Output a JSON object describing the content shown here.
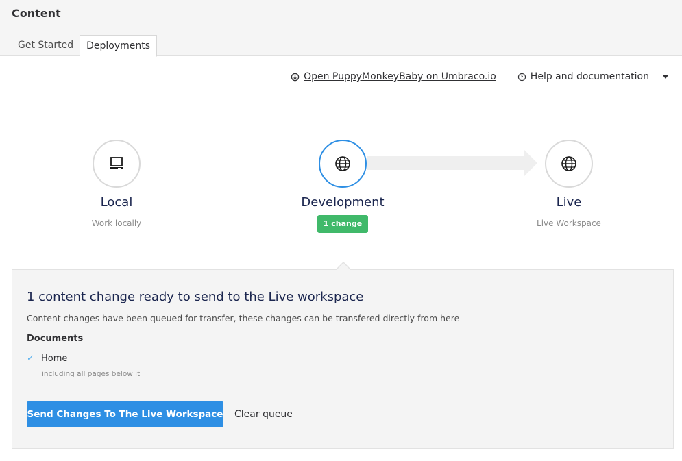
{
  "header": {
    "title": "Content",
    "tabs": [
      {
        "label": "Get Started",
        "active": false
      },
      {
        "label": "Deployments",
        "active": true
      }
    ]
  },
  "toplinks": {
    "open_project": {
      "label": "Open PuppyMonkeyBaby on Umbraco.io",
      "icon": "umbraco-cloud-icon"
    },
    "help": {
      "label": "Help and documentation",
      "icon": "question-circle-icon"
    },
    "menu_icon": "caret-down-icon"
  },
  "environments": [
    {
      "name": "Local",
      "subtitle": "Work locally",
      "icon": "laptop-icon",
      "active": false
    },
    {
      "name": "Development",
      "badge": "1 change",
      "icon": "globe-icon",
      "active": true
    },
    {
      "name": "Live",
      "subtitle": "Live Workspace",
      "icon": "globe-icon",
      "active": false
    }
  ],
  "panel": {
    "title": "1 content change ready to send to the Live workspace",
    "description": "Content changes have been queued for transfer, these changes can be transfered directly from here",
    "documents_heading": "Documents",
    "documents": [
      {
        "name": "Home",
        "note": "including all pages below it",
        "icon": "checkmark-icon"
      }
    ],
    "send_button": "Send Changes To The Live Workspace",
    "clear_button": "Clear queue"
  },
  "colors": {
    "accent": "#2e8fe4",
    "badge": "#40b96a",
    "check": "#5ab1ef"
  }
}
